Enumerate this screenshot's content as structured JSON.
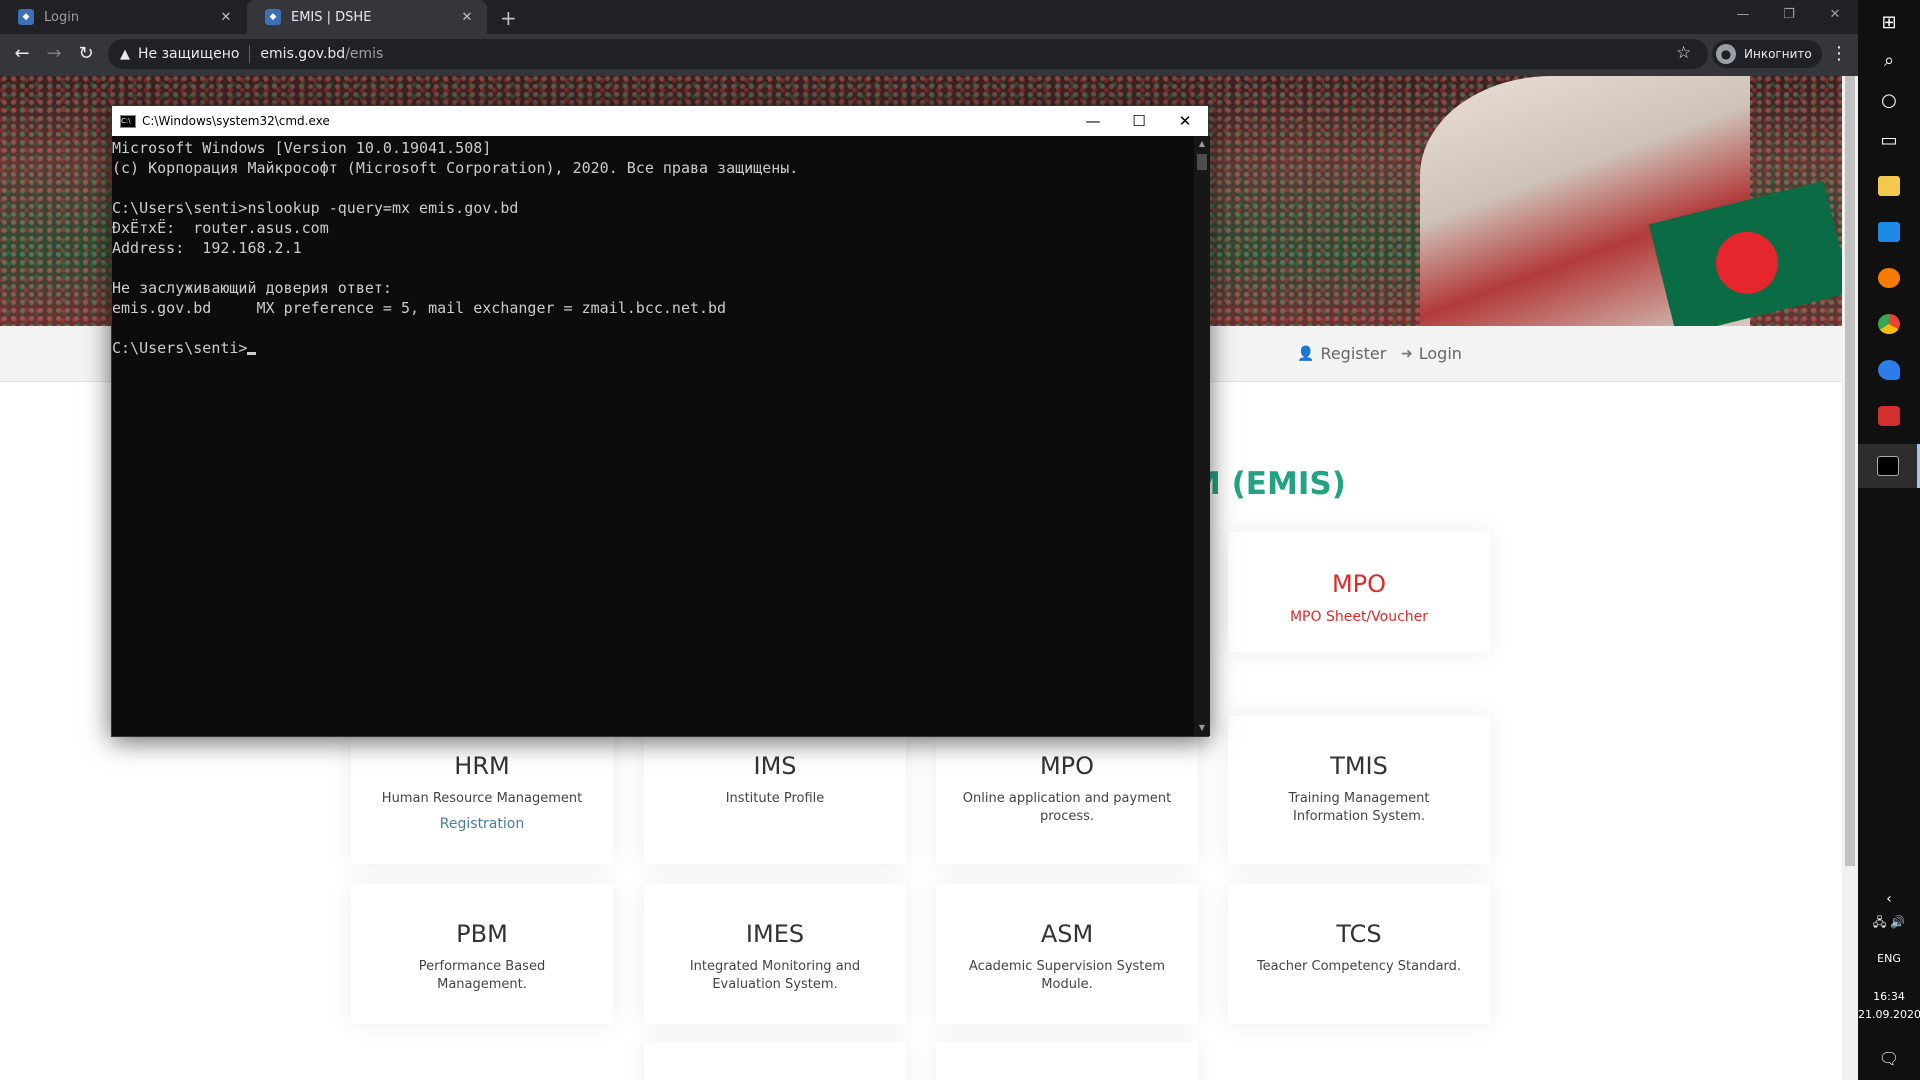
{
  "browser": {
    "tabs": [
      {
        "label": "Login",
        "active": false
      },
      {
        "label": "EMIS | DSHE",
        "active": true
      }
    ],
    "new_tab": "+",
    "security_warning": "Не защищено",
    "url_host": "emis.gov.bd",
    "url_path": "/emis",
    "incognito_label": "Инкогнито",
    "win_minimize": "—",
    "win_restore": "❐",
    "win_close": "✕"
  },
  "page": {
    "nav": {
      "register": "Register",
      "login": "Login"
    },
    "heading_visible": "M (EMIS)",
    "cards": [
      {
        "title": "MPO",
        "desc": "MPO Sheet/Voucher",
        "style": "red"
      },
      {
        "title": "HRM",
        "desc": "Human Resource Management",
        "link": "Registration"
      },
      {
        "title": "IMS",
        "desc": "Institute Profile"
      },
      {
        "title": "MPO",
        "desc": "Online application and payment process."
      },
      {
        "title": "TMIS",
        "desc": "Training Management Information System."
      },
      {
        "title": "PBM",
        "desc": "Performance Based Management."
      },
      {
        "title": "IMES",
        "desc": "Integrated Monitoring and Evaluation System."
      },
      {
        "title": "ASM",
        "desc": "Academic Supervision System Module."
      },
      {
        "title": "TCS",
        "desc": "Teacher Competency Standard."
      }
    ]
  },
  "cmd": {
    "title": "C:\\Windows\\system32\\cmd.exe",
    "lines": [
      "Microsoft Windows [Version 10.0.19041.508]",
      "(c) Корпорация Майкрософт (Microsoft Corporation), 2020. Все права защищены.",
      "",
      "C:\\Users\\senti>nslookup -query=mx emis.gov.bd",
      "ÐxЁтxЁ:  router.asus.com",
      "Address:  192.168.2.1",
      "",
      "Не заслуживающий доверия ответ:",
      "emis.gov.bd     MX preference = 5, mail exchanger = zmail.bcc.net.bd",
      ""
    ],
    "prompt": "C:\\Users\\senti>"
  },
  "taskbar": {
    "language": "ENG",
    "time": "16:34",
    "date": "21.09.2020"
  },
  "colors": {
    "accent_green": "#23a384",
    "mpo_red": "#e02a2a",
    "link_blue": "#4a7aab"
  }
}
